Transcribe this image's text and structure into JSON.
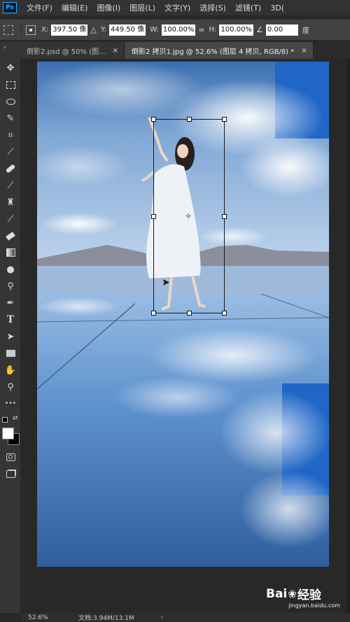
{
  "app": {
    "logo_text": "Ps"
  },
  "menu": {
    "items": [
      "文件(F)",
      "编辑(E)",
      "图像(I)",
      "图层(L)",
      "文字(Y)",
      "选择(S)",
      "滤镜(T)",
      "3D("
    ]
  },
  "options": {
    "x_label": "X:",
    "x_value": "397.50 像",
    "y_label": "Y:",
    "y_value": "449.50 像",
    "w_label": "W:",
    "w_value": "100.00%",
    "h_label": "H:",
    "h_value": "100.00%",
    "angle_value": "0.00",
    "trailing_label": "度"
  },
  "tabs": [
    {
      "label": "倒影2.psd @ 50% (图...",
      "close": "×",
      "active": false
    },
    {
      "label": "倒影2 拷贝1.jpg @ 52.6% (图层 4 拷贝, RGB/8) *",
      "close": "×",
      "active": true
    }
  ],
  "tools": [
    "move-tool",
    "marquee-tool",
    "lasso-tool",
    "quick-select-tool",
    "crop-tool",
    "eyedropper-tool",
    "healing-brush-tool",
    "brush-tool",
    "clone-stamp-tool",
    "history-brush-tool",
    "eraser-tool",
    "gradient-tool",
    "blur-tool",
    "dodge-tool",
    "pen-tool",
    "type-tool",
    "path-select-tool",
    "rectangle-tool",
    "hand-tool",
    "zoom-tool",
    "more-tools"
  ],
  "type_tool_glyph": "T",
  "more_tools_glyph": "•••",
  "status": {
    "zoom": "52.6%",
    "doc_info": "文档:3.94M/13.1M",
    "arrow": "›"
  },
  "watermark": {
    "brand": "Bai",
    "brand_suffix": "经验",
    "url": "jingyan.baidu.com"
  },
  "colors": {
    "sky_top": "#2b6fc0",
    "sky_mid": "#8fb4de",
    "water": "#5a8fcf",
    "ui_dark": "#282828",
    "ps_blue": "#31a8ff"
  }
}
